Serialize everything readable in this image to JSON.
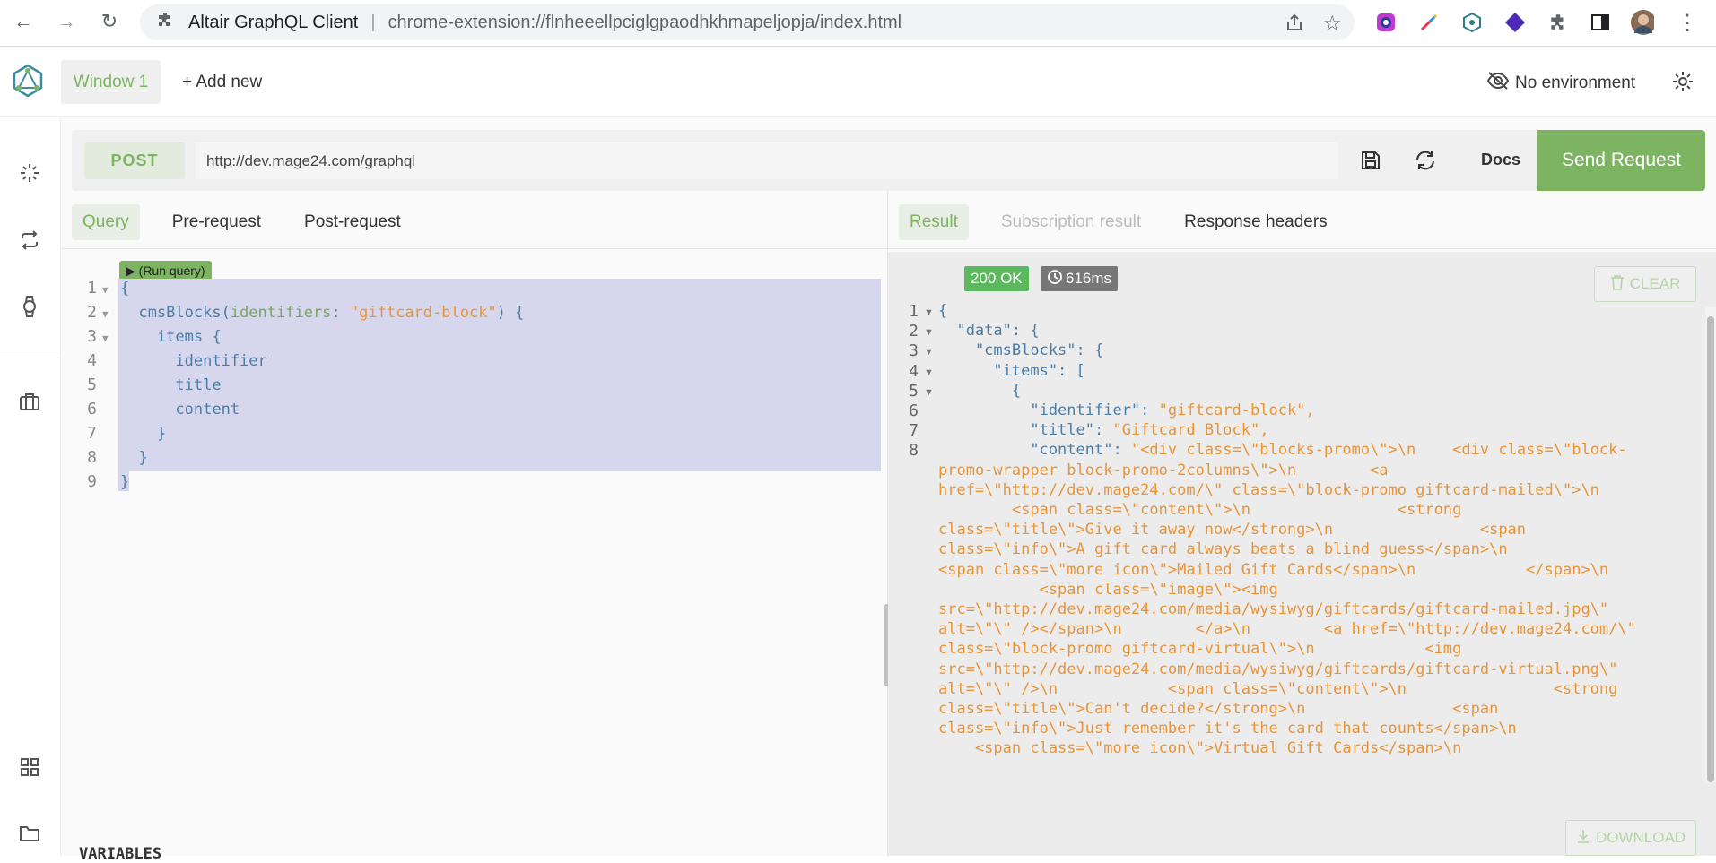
{
  "browser": {
    "site_name": "Altair GraphQL Client",
    "url": "chrome-extension://flnheeellpciglgpaodhkhmapeljopja/index.html"
  },
  "header": {
    "window_tab": "Window 1",
    "add_new": "+ Add new",
    "environment": "No environment"
  },
  "request": {
    "method": "POST",
    "url": "http://dev.mage24.com/graphql",
    "docs": "Docs",
    "send": "Send Request"
  },
  "query_tabs": [
    "Query",
    "Pre-request",
    "Post-request"
  ],
  "result_tabs": [
    "Result",
    "Subscription result",
    "Response headers"
  ],
  "editor": {
    "run_query": "(Run query)",
    "line_numbers": [
      "1",
      "2",
      "3",
      "4",
      "5",
      "6",
      "7",
      "8",
      "9"
    ],
    "lines": [
      "{",
      "  cmsBlocks(identifiers: \"giftcard-block\") {",
      "    items {",
      "      identifier",
      "      title",
      "      content",
      "    }",
      "  }",
      "}"
    ]
  },
  "result": {
    "status": "200 OK",
    "time": "616ms",
    "clear": "CLEAR",
    "download": "DOWNLOAD",
    "line_numbers": [
      "1",
      "2",
      "3",
      "4",
      "5",
      "6",
      "7",
      "8"
    ],
    "json_lines": [
      "{",
      "  \"data\": {",
      "    \"cmsBlocks\": {",
      "      \"items\": [",
      "        {",
      "          \"identifier\": \"giftcard-block\",",
      "          \"title\": \"Giftcard Block\",",
      "          \"content\": \"<div class=\\\"blocks-promo\\\">\\n    <div class=\\\"block-",
      "promo-wrapper block-promo-2columns\\\">\\n        <a",
      "href=\\\"http://dev.mage24.com/\\\" class=\\\"block-promo giftcard-mailed\\\">\\n",
      "        <span class=\\\"content\\\">\\n                <strong",
      "class=\\\"title\\\">Give it away now</strong>\\n                <span",
      "class=\\\"info\\\">A gift card always beats a blind guess</span>\\n",
      "<span class=\\\"more icon\\\">Mailed Gift Cards</span>\\n            </span>\\n",
      "           <span class=\\\"image\\\"><img",
      "src=\\\"http://dev.mage24.com/media/wysiwyg/giftcards/giftcard-mailed.jpg\\\"",
      "alt=\\\"\\\" /></span>\\n        </a>\\n        <a href=\\\"http://dev.mage24.com/\\\"",
      "class=\\\"block-promo giftcard-virtual\\\">\\n            <img",
      "src=\\\"http://dev.mage24.com/media/wysiwyg/giftcards/giftcard-virtual.png\\\"",
      "alt=\\\"\\\" />\\n            <span class=\\\"content\\\">\\n                <strong",
      "class=\\\"title\\\">Can't decide?</strong>\\n                <span",
      "class=\\\"info\\\">Just remember it's the card that counts</span>\\n",
      "    <span class=\\\"more icon\\\">Virtual Gift Cards</span>\\n"
    ]
  },
  "variables_label": "VARIABLES"
}
